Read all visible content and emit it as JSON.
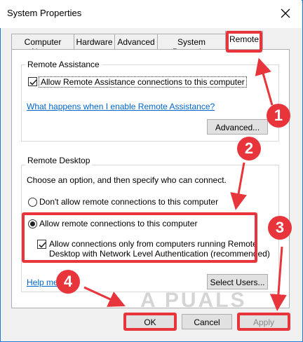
{
  "window": {
    "title": "System Properties"
  },
  "tabs": [
    {
      "label": "Computer Name"
    },
    {
      "label": "Hardware"
    },
    {
      "label": "Advanced"
    },
    {
      "label": "System Protection"
    },
    {
      "label": "Remote"
    }
  ],
  "remote_assistance": {
    "group_label": "Remote Assistance",
    "allow_label": "Allow Remote Assistance connections to this computer",
    "help_link": "What happens when I enable Remote Assistance?",
    "advanced_button": "Advanced..."
  },
  "remote_desktop": {
    "group_label": "Remote Desktop",
    "instruction": "Choose an option, and then specify who can connect.",
    "dont_allow_label": "Don't allow remote connections to this computer",
    "allow_label": "Allow remote connections to this computer",
    "nla_line1": "Allow connections only from computers running Remote",
    "nla_line2": "Desktop with Network Level Authentication (recommended)",
    "help_link": "Help me",
    "select_users_button": "Select Users..."
  },
  "footer": {
    "ok": "OK",
    "cancel": "Cancel",
    "apply": "Apply"
  },
  "annotations": {
    "badge1": "1",
    "badge2": "2",
    "badge3": "3",
    "badge4": "4",
    "accent": "#e8343b"
  },
  "watermark": "A PUALS"
}
